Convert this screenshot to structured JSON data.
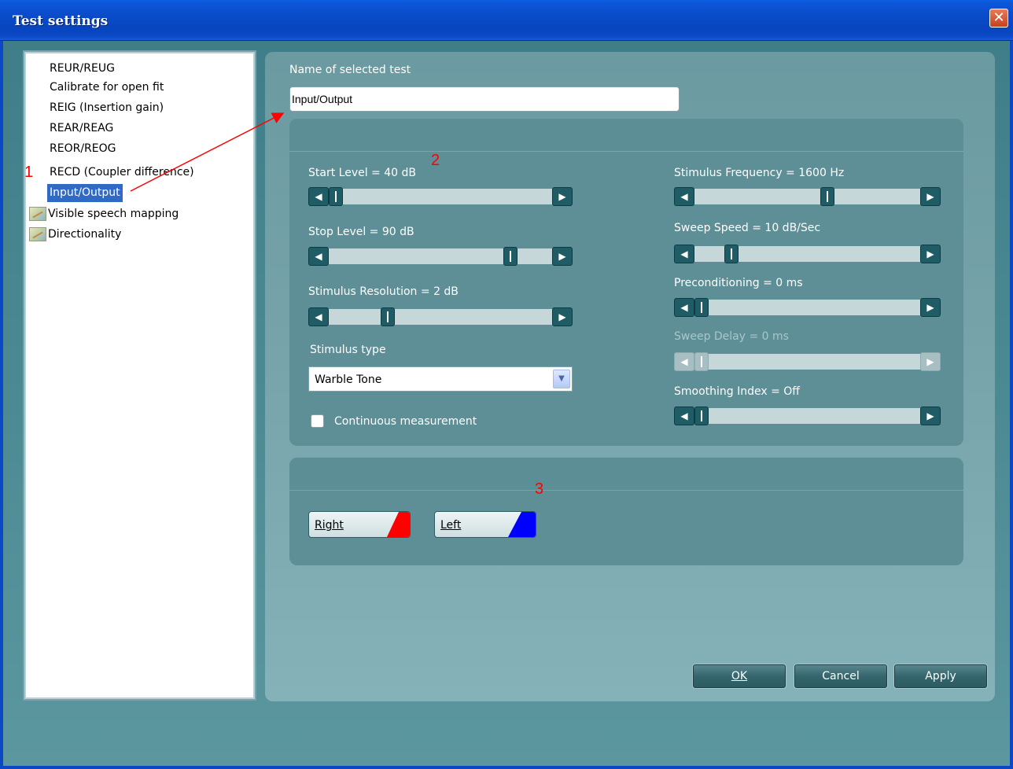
{
  "window": {
    "title": "Test settings"
  },
  "test_list": {
    "items": [
      {
        "label": "REUR/REUG",
        "icon": false
      },
      {
        "label": "Calibrate for open fit",
        "icon": false
      },
      {
        "label": "REIG (Insertion gain)",
        "icon": false
      },
      {
        "label": "REAR/REAG",
        "icon": false
      },
      {
        "label": "REOR/REOG",
        "icon": false
      },
      {
        "label": "RECD (Coupler difference)",
        "icon": false
      },
      {
        "label": "Input/Output",
        "icon": false,
        "selected": true
      },
      {
        "label": "Visible speech mapping",
        "icon": "speech-mapping-icon"
      },
      {
        "label": "Directionality",
        "icon": "speech-mapping-icon"
      }
    ]
  },
  "name_field": {
    "label": "Name of selected test",
    "value": "Input/Output"
  },
  "settings": {
    "start_level": {
      "label": "Start Level = 40 dB",
      "position": 0.0
    },
    "stop_level": {
      "label": "Stop Level = 90 dB",
      "position": 0.85
    },
    "stimulus_resolution": {
      "label": "Stimulus Resolution = 2 dB",
      "position": 0.25
    },
    "stimulus_type": {
      "label": "Stimulus type",
      "value": "Warble Tone"
    },
    "continuous": {
      "label": "Continuous measurement",
      "checked": false
    },
    "stimulus_frequency": {
      "label": "Stimulus Frequency = 1600 Hz",
      "position": 0.6
    },
    "sweep_speed": {
      "label": "Sweep Speed = 10 dB/Sec",
      "position": 0.2
    },
    "preconditioning": {
      "label": "Preconditioning = 0 ms",
      "position": 0.0
    },
    "sweep_delay": {
      "label": "Sweep Delay = 0 ms",
      "position": 0.0,
      "disabled": true
    },
    "smoothing_index": {
      "label": "Smoothing Index = Off",
      "position": 0.0
    }
  },
  "ear_buttons": {
    "right": {
      "label": "Right",
      "color": "#ff0000"
    },
    "left": {
      "label": "Left",
      "color": "#0000ff"
    }
  },
  "footer": {
    "ok": "OK",
    "cancel": "Cancel",
    "apply": "Apply"
  },
  "annotations": {
    "one": "1",
    "two": "2",
    "three": "3",
    "color": "#ff0000"
  }
}
